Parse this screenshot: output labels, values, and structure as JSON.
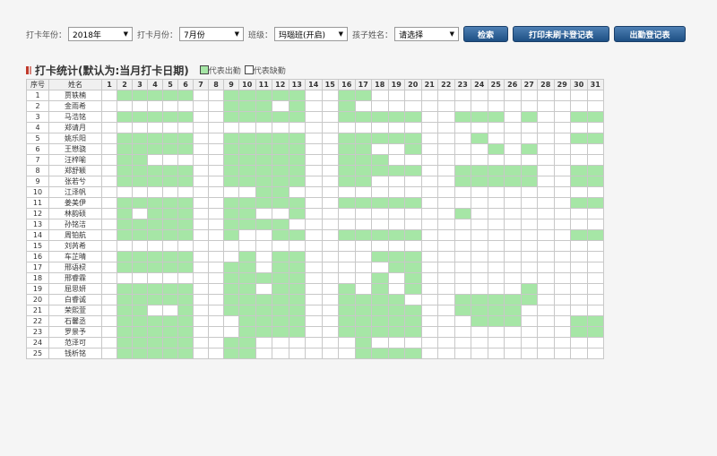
{
  "filters": {
    "year_label": "打卡年份：",
    "year_value": "2018年",
    "month_label": "打卡月份：",
    "month_value": "7月份",
    "class_label": "班级：",
    "class_value": "玛瑙班(开启)",
    "child_label": "孩子姓名：",
    "child_value": "请选择"
  },
  "buttons": {
    "search": "检索",
    "print": "打印未刷卡登记表",
    "attendance": "出勤登记表"
  },
  "section": {
    "title": "打卡统计(默认为:当月打卡日期)",
    "legend_present": "代表出勤",
    "legend_absent": "代表缺勤"
  },
  "colors": {
    "present": "#a6e6a6",
    "button": "#2a5d94",
    "marker": "#c0392b"
  },
  "table": {
    "header_seq": "序号",
    "header_name": "姓名",
    "days": [
      "1",
      "2",
      "3",
      "4",
      "5",
      "6",
      "7",
      "8",
      "9",
      "10",
      "11",
      "12",
      "13",
      "14",
      "15",
      "16",
      "17",
      "18",
      "19",
      "20",
      "21",
      "22",
      "23",
      "24",
      "25",
      "26",
      "27",
      "28",
      "29",
      "30",
      "31"
    ],
    "rows": [
      {
        "seq": "1",
        "name": "贾轶楠",
        "present": [
          2,
          3,
          4,
          5,
          6,
          9,
          10,
          11,
          12,
          13,
          16,
          17
        ]
      },
      {
        "seq": "2",
        "name": "金雨希",
        "present": [
          9,
          10,
          11,
          13,
          16
        ]
      },
      {
        "seq": "3",
        "name": "马浩铭",
        "present": [
          2,
          3,
          4,
          5,
          6,
          9,
          10,
          11,
          12,
          13,
          16,
          17,
          18,
          19,
          20,
          23,
          24,
          25,
          27,
          30,
          31
        ]
      },
      {
        "seq": "4",
        "name": "郑请月",
        "present": []
      },
      {
        "seq": "5",
        "name": "姚乐阳",
        "present": [
          2,
          3,
          4,
          5,
          6,
          9,
          10,
          11,
          12,
          13,
          16,
          17,
          18,
          19,
          20,
          24,
          30,
          31
        ]
      },
      {
        "seq": "6",
        "name": "王懋骁",
        "present": [
          2,
          3,
          4,
          5,
          6,
          9,
          10,
          11,
          12,
          13,
          16,
          17,
          20,
          25,
          27
        ]
      },
      {
        "seq": "7",
        "name": "汪梓喻",
        "present": [
          2,
          3,
          9,
          10,
          11,
          12,
          13,
          16,
          17,
          18
        ]
      },
      {
        "seq": "8",
        "name": "郑舒颖",
        "present": [
          2,
          3,
          4,
          5,
          6,
          9,
          10,
          11,
          12,
          13,
          16,
          17,
          18,
          19,
          20,
          23,
          24,
          25,
          26,
          27,
          30,
          31
        ]
      },
      {
        "seq": "9",
        "name": "张若兮",
        "present": [
          2,
          3,
          4,
          5,
          6,
          9,
          10,
          11,
          12,
          13,
          16,
          17,
          23,
          24,
          25,
          26,
          27,
          30,
          31
        ]
      },
      {
        "seq": "10",
        "name": "江泽帆",
        "present": [
          11,
          12
        ]
      },
      {
        "seq": "11",
        "name": "姜美伊",
        "present": [
          2,
          3,
          4,
          5,
          6,
          9,
          10,
          11,
          12,
          13,
          16,
          17,
          18,
          19,
          20,
          30,
          31
        ]
      },
      {
        "seq": "12",
        "name": "林韵硕",
        "present": [
          2,
          4,
          5,
          6,
          9,
          10,
          13,
          23
        ]
      },
      {
        "seq": "13",
        "name": "孙铭洁",
        "present": [
          2,
          3,
          4,
          5,
          6,
          9,
          10,
          11,
          12
        ]
      },
      {
        "seq": "14",
        "name": "周铂航",
        "present": [
          2,
          3,
          4,
          5,
          6,
          9,
          12,
          13,
          16,
          17,
          18,
          19,
          20,
          30,
          31
        ]
      },
      {
        "seq": "15",
        "name": "刘芮希",
        "present": []
      },
      {
        "seq": "16",
        "name": "车芷晴",
        "present": [
          2,
          3,
          4,
          5,
          6,
          10,
          12,
          13,
          18,
          19,
          20
        ]
      },
      {
        "seq": "17",
        "name": "邢语棂",
        "present": [
          2,
          3,
          4,
          5,
          6,
          9,
          10,
          12,
          13,
          19,
          20
        ]
      },
      {
        "seq": "18",
        "name": "邢睿霖",
        "present": [
          9,
          10,
          11,
          12,
          13,
          18,
          20
        ]
      },
      {
        "seq": "19",
        "name": "屈思妍",
        "present": [
          2,
          3,
          4,
          5,
          6,
          9,
          10,
          12,
          13,
          16,
          18,
          20,
          27
        ]
      },
      {
        "seq": "20",
        "name": "白睿诚",
        "present": [
          2,
          3,
          4,
          5,
          6,
          9,
          10,
          11,
          12,
          13,
          16,
          17,
          18,
          19,
          23,
          24,
          25,
          26,
          27
        ]
      },
      {
        "seq": "21",
        "name": "荣熙萱",
        "present": [
          2,
          3,
          6,
          9,
          10,
          11,
          12,
          13,
          16,
          17,
          18,
          19,
          20,
          23,
          24,
          25,
          26
        ]
      },
      {
        "seq": "22",
        "name": "石馨丞",
        "present": [
          2,
          3,
          4,
          5,
          6,
          10,
          11,
          12,
          13,
          16,
          17,
          18,
          19,
          20,
          24,
          25,
          26,
          30,
          31
        ]
      },
      {
        "seq": "23",
        "name": "罗景予",
        "present": [
          2,
          3,
          4,
          5,
          6,
          10,
          11,
          12,
          13,
          16,
          17,
          18,
          19,
          20,
          30,
          31
        ]
      },
      {
        "seq": "24",
        "name": "范泽可",
        "present": [
          2,
          3,
          4,
          5,
          6,
          9,
          10,
          17
        ]
      },
      {
        "seq": "25",
        "name": "钱析铭",
        "present": [
          2,
          3,
          4,
          5,
          6,
          9,
          10,
          17,
          18,
          19,
          20
        ]
      }
    ]
  }
}
